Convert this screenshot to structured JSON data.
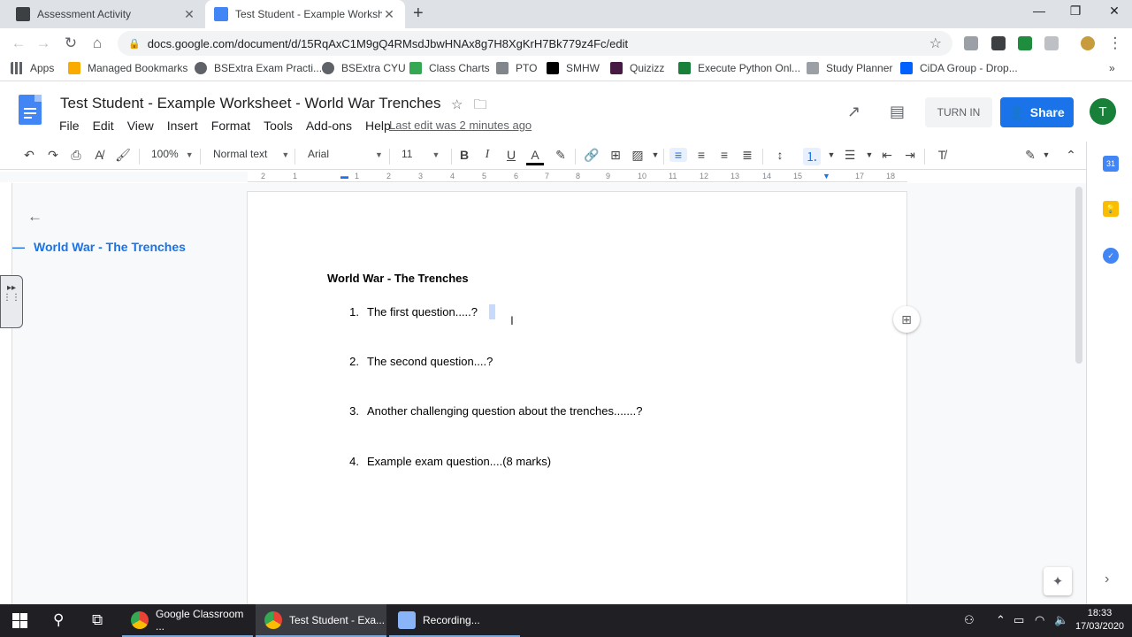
{
  "browser": {
    "tabs": [
      {
        "title": "Assessment Activity",
        "active": false
      },
      {
        "title": "Test Student - Example Worksheet",
        "active": true
      }
    ],
    "url": "docs.google.com/document/d/15RqAxC1M9gQ4RMsdJbwHNAx8g7H8XgKrH7Bk779z4Fc/edit",
    "bookmarks": [
      "Apps",
      "Managed Bookmarks",
      "BSExtra Exam Practi...",
      "BSExtra CYU",
      "Class Charts",
      "PTO",
      "SMHW",
      "Quizizz",
      "Execute Python Onl...",
      "Study Planner",
      "CiDA Group - Drop..."
    ]
  },
  "docs": {
    "title": "Test Student - Example Worksheet - World War Trenches",
    "menu": [
      "File",
      "Edit",
      "View",
      "Insert",
      "Format",
      "Tools",
      "Add-ons",
      "Help"
    ],
    "last_edit": "Last edit was 2 minutes ago",
    "turn_in": "TURN IN",
    "share": "Share",
    "avatar_letter": "T",
    "toolbar": {
      "zoom": "100%",
      "style": "Normal text",
      "font": "Arial",
      "size": "11"
    },
    "ruler_ticks": [
      "2",
      "1",
      "1",
      "2",
      "3",
      "4",
      "5",
      "6",
      "7",
      "8",
      "9",
      "10",
      "11",
      "12",
      "13",
      "14",
      "15",
      "16",
      "17",
      "18"
    ]
  },
  "outline": {
    "items": [
      "World War - The Trenches"
    ]
  },
  "document": {
    "heading": "World War - The Trenches",
    "questions": [
      {
        "num": "1.",
        "text": "The first question.....?"
      },
      {
        "num": "2.",
        "text": "The second question....?"
      },
      {
        "num": "3.",
        "text": "Another challenging question about the trenches.......?"
      },
      {
        "num": "4.",
        "text": "Example exam question....(8 marks)"
      }
    ]
  },
  "taskbar": {
    "apps": [
      "Google Classroom ...",
      "Test Student - Exa...",
      "Recording..."
    ],
    "time": "18:33",
    "date": "17/03/2020"
  },
  "colors": {
    "accent": "#1a73e8",
    "docs_blue": "#4285f4",
    "avatar": "#188038"
  }
}
